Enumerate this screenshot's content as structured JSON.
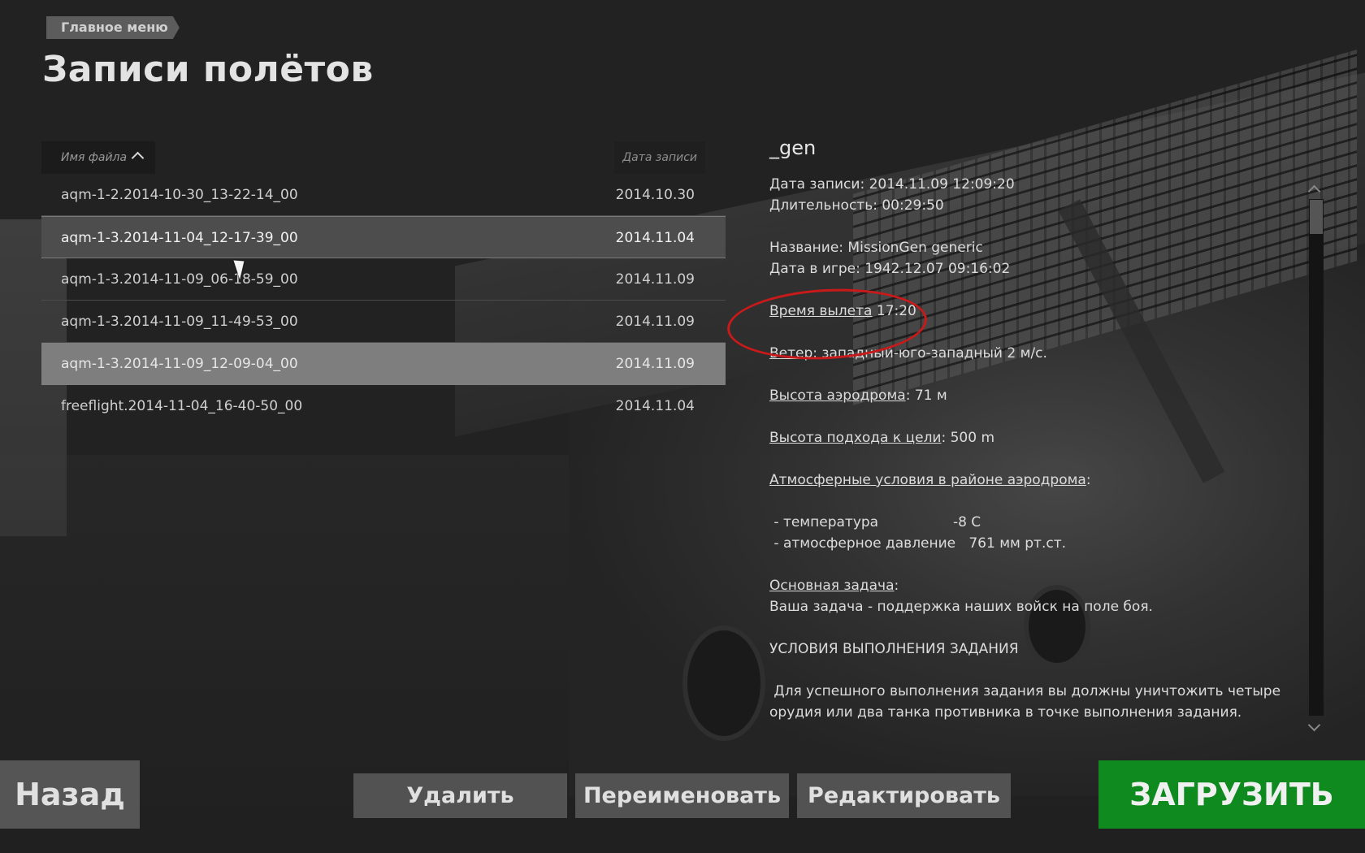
{
  "breadcrumb": "Главное меню",
  "title": "Записи полётов",
  "list": {
    "sort_label": "Имя файла",
    "date_header": "Дата записи",
    "rows": [
      {
        "name": "aqm-1-2.2014-10-30_13-22-14_00",
        "date": "2014.10.30",
        "state": "normal"
      },
      {
        "name": "aqm-1-3.2014-11-04_12-17-39_00",
        "date": "2014.11.04",
        "state": "hover"
      },
      {
        "name": "aqm-1-3.2014-11-09_06-18-59_00",
        "date": "2014.11.09",
        "state": "normal"
      },
      {
        "name": "aqm-1-3.2014-11-09_11-49-53_00",
        "date": "2014.11.09",
        "state": "normal"
      },
      {
        "name": "aqm-1-3.2014-11-09_12-09-04_00",
        "date": "2014.11.09",
        "state": "selected"
      },
      {
        "name": "freeflight.2014-11-04_16-40-50_00",
        "date": "2014.11.04",
        "state": "normal"
      }
    ]
  },
  "details": {
    "record_name": "_gen",
    "record_date": "Дата записи: 2014.11.09 12:09:20",
    "duration": "Длительность: 00:29:50",
    "mission_name": "Название: MissionGen generic",
    "game_date": "Дата в игре: 1942.12.07 09:16:02",
    "departure_label": "Время вылета",
    "departure_value": " 17:20",
    "wind_label": "Ветер",
    "wind_value": ": западный-юго-западный 2 м/с.",
    "airfield_alt_label": "Высота аэродрома",
    "airfield_alt_value": ": 71 м",
    "approach_alt_label": "Высота подхода к цели",
    "approach_alt_value": ": 500 m",
    "atmo_label": "Атмосферные условия в районе аэродрома",
    "atmo_suffix": ":",
    "temp_line": " - температура                 -8 C",
    "pressure_line": " - атмосферное давление   761 мм рт.ст.",
    "main_task_label": "Основная задача",
    "main_task_suffix": ":",
    "main_task_text": "Ваша задача - поддержка наших войск на поле боя.",
    "conditions_header": "УСЛОВИЯ ВЫПОЛНЕНИЯ ЗАДАНИЯ",
    "conditions_text": " Для успешного выполнения задания вы должны уничтожить четыре орудия или два танка противника в точке выполнения задания."
  },
  "buttons": {
    "back": "Назад",
    "delete": "Удалить",
    "rename": "Переименовать",
    "edit": "Редактировать",
    "load": "ЗАГРУЗИТЬ"
  },
  "colors": {
    "load_button": "#0e8a1f",
    "annotation_circle": "#c81a1a",
    "selected_row": "#7e7e7e"
  },
  "icons": [
    "sort-ascending-icon",
    "scroll-up-icon",
    "scroll-down-icon",
    "mouse-cursor-icon"
  ]
}
